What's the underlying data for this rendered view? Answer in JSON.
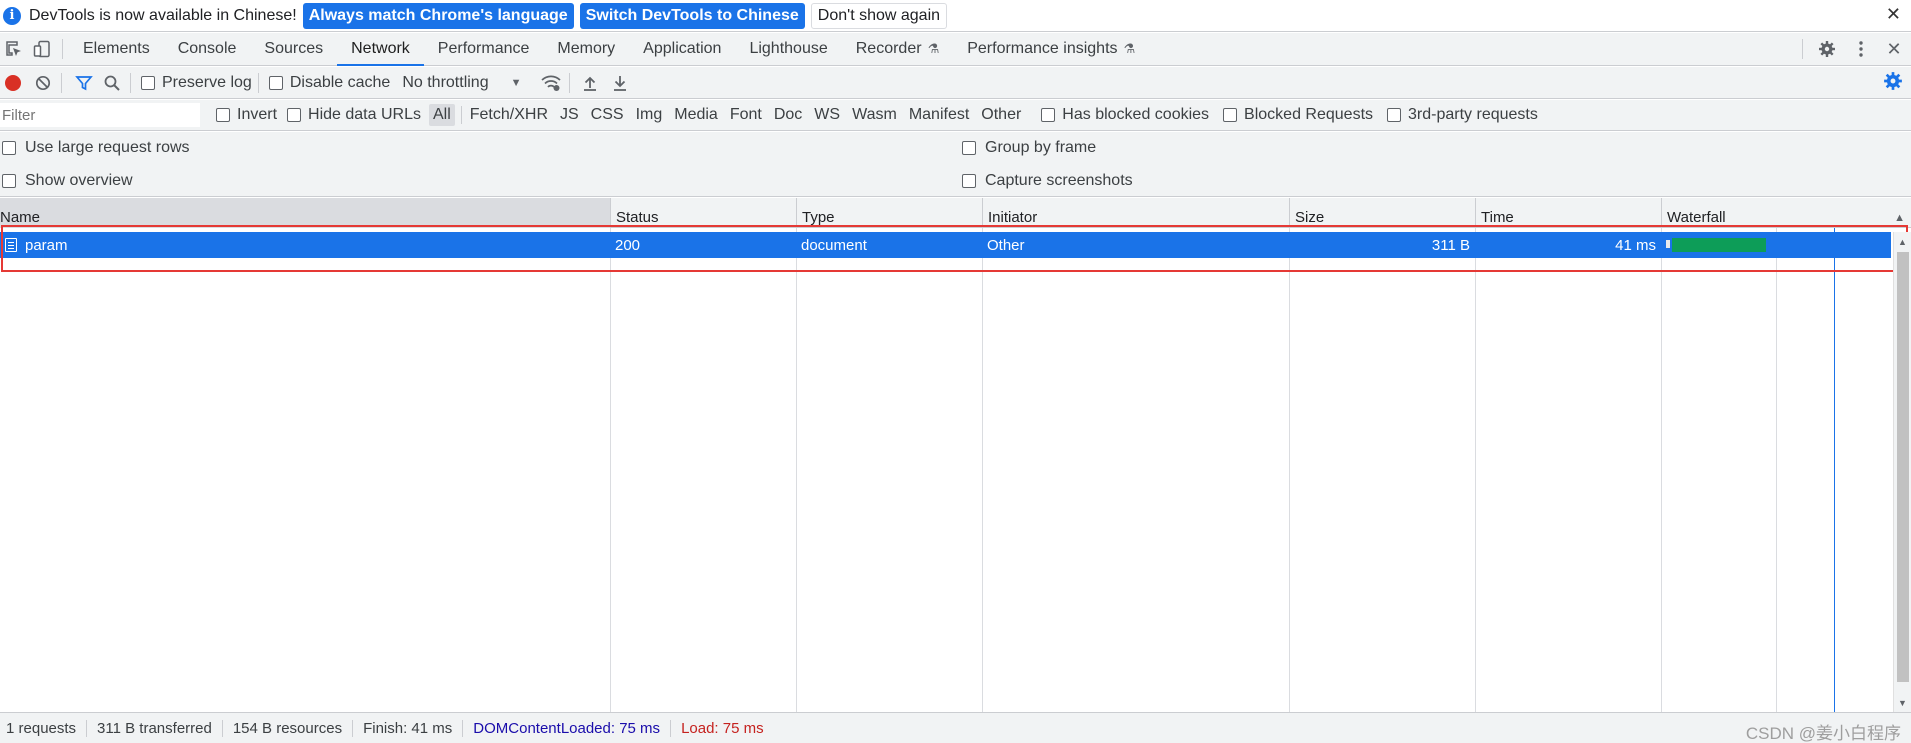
{
  "infobar": {
    "message": "DevTools is now available in Chinese!",
    "btn_match": "Always match Chrome's language",
    "btn_switch": "Switch DevTools to Chinese",
    "btn_dont_show": "Don't show again",
    "close": "✕"
  },
  "tabs": [
    {
      "label": "Elements"
    },
    {
      "label": "Console"
    },
    {
      "label": "Sources"
    },
    {
      "label": "Network"
    },
    {
      "label": "Performance"
    },
    {
      "label": "Memory"
    },
    {
      "label": "Application"
    },
    {
      "label": "Lighthouse"
    },
    {
      "label": "Recorder"
    },
    {
      "label": "Performance insights"
    }
  ],
  "active_tab": "Network",
  "toolbar": {
    "preserve_log": "Preserve log",
    "disable_cache": "Disable cache",
    "throttling": "No throttling"
  },
  "filter": {
    "placeholder": "Filter",
    "invert": "Invert",
    "hide_data_urls": "Hide data URLs",
    "types": [
      "All",
      "Fetch/XHR",
      "JS",
      "CSS",
      "Img",
      "Media",
      "Font",
      "Doc",
      "WS",
      "Wasm",
      "Manifest",
      "Other"
    ],
    "has_blocked_cookies": "Has blocked cookies",
    "blocked_requests": "Blocked Requests",
    "third_party": "3rd-party requests"
  },
  "options": {
    "large_rows": "Use large request rows",
    "show_overview": "Show overview",
    "group_by_frame": "Group by frame",
    "capture_screenshots": "Capture screenshots"
  },
  "columns": [
    "Name",
    "Status",
    "Type",
    "Initiator",
    "Size",
    "Time",
    "Waterfall"
  ],
  "requests": [
    {
      "name": "param",
      "status": "200",
      "type": "document",
      "initiator": "Other",
      "size": "311 B",
      "time": "41 ms"
    }
  ],
  "status": {
    "requests": "1 requests",
    "transferred": "311 B transferred",
    "resources": "154 B resources",
    "finish": "Finish: 41 ms",
    "dom_content_loaded": "DOMContentLoaded: 75 ms",
    "load": "Load: 75 ms"
  },
  "watermark": "CSDN @姜小白程序",
  "colors": {
    "accent": "#1a73e8",
    "record": "#d93025",
    "waterfall_bar": "#0d9d58",
    "highlight": "#e53935"
  }
}
